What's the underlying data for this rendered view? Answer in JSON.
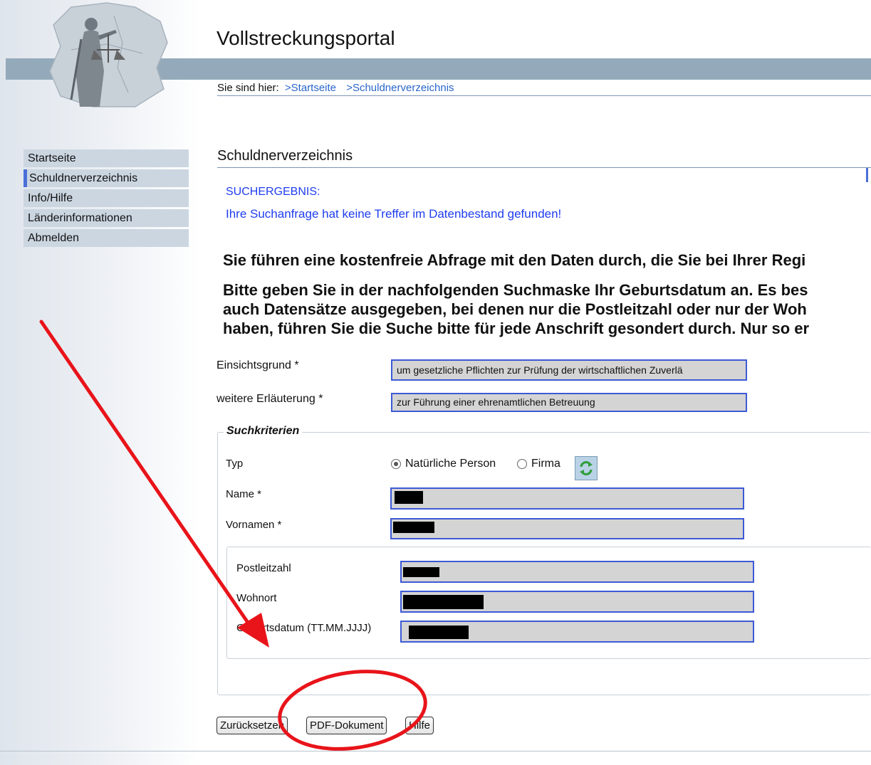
{
  "header": {
    "app_title": "Vollstreckungsportal",
    "breadcrumb": {
      "prefix": "Sie sind hier:",
      "items": [
        ">Startseite",
        ">Schuldnerverzeichnis"
      ]
    }
  },
  "nav": {
    "items": [
      "Startseite",
      "Schuldnerverzeichnis",
      "Info/Hilfe",
      "Länderinformationen",
      "Abmelden"
    ],
    "active": "Schuldnerverzeichnis"
  },
  "main": {
    "section_title": "Schuldnerverzeichnis",
    "result_label": "SUCHERGEBNIS:",
    "result_message": "Ihre Suchanfrage hat keine Treffer im Datenbestand gefunden!",
    "info_line": "Sie führen eine kostenfreie Abfrage mit den Daten durch, die Sie bei Ihrer Regi",
    "instructions": [
      "Bitte geben Sie in der nachfolgenden Suchmaske Ihr Geburtsdatum an. Es bes",
      "auch Datensätze ausgegeben, bei denen nur die Postleitzahl oder nur der Woh",
      "haben, führen Sie die Suche bitte für jede Anschrift gesondert durch. Nur so er"
    ]
  },
  "form": {
    "einsichtsgrund": {
      "label": "Einsichtsgrund *",
      "value": "um gesetzliche Pflichten zur Prüfung der wirtschaftlichen Zuverlä"
    },
    "erlaeuterung": {
      "label": "weitere Erläuterung *",
      "value": "zur Führung einer ehrenamtlichen Betreuung"
    },
    "suchkriterien": {
      "legend": "Suchkriterien",
      "typ_label": "Typ",
      "typ_options": [
        "Natürliche Person",
        "Firma"
      ],
      "typ_selected": "Natürliche Person",
      "name_label": "Name *",
      "vornamen_label": "Vornamen *",
      "plz_label": "Postleitzahl",
      "wohnort_label": "Wohnort",
      "geburtsdatum_label": "Geburtsdatum (TT.MM.JJJJ)"
    }
  },
  "buttons": {
    "reset": "Zurücksetzen",
    "pdf": "PDF-Dokument",
    "help": "Hilfe"
  },
  "colors": {
    "banner": "#94aabb",
    "nav_bg": "#cbd6e1",
    "link_blue": "#1f3df0",
    "field_border": "#3d5ad6",
    "annotation_red": "#e8141a"
  },
  "icons": {
    "logo": "justitia-logo",
    "refresh": "refresh-icon"
  }
}
